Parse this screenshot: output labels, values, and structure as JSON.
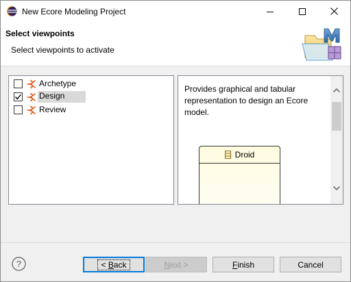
{
  "window": {
    "title": "New Ecore Modeling Project",
    "app_icon": "eclipse-icon"
  },
  "banner": {
    "title": "Select viewpoints",
    "description": "Select viewpoints to activate",
    "logo": "modeling-project-wizard-icon"
  },
  "viewpoints": [
    {
      "label": "Archetype",
      "checked": false,
      "selected": false
    },
    {
      "label": "Design",
      "checked": true,
      "selected": true
    },
    {
      "label": "Review",
      "checked": false,
      "selected": false
    }
  ],
  "description": {
    "text": "Provides graphical and tabular representation to design an Ecore model.",
    "preview_class_name": "Droid"
  },
  "buttons": {
    "back": {
      "mnemonic": "B",
      "rest": "ack",
      "prefix": "< "
    },
    "next": {
      "mnemonic": "N",
      "rest": "ext >"
    },
    "finish": {
      "mnemonic": "F",
      "rest": "inish"
    },
    "cancel": "Cancel"
  },
  "colors": {
    "accent": "#0078d7",
    "viewpoint_icon": "#e05a1a",
    "selection": "#d9d9d9"
  }
}
